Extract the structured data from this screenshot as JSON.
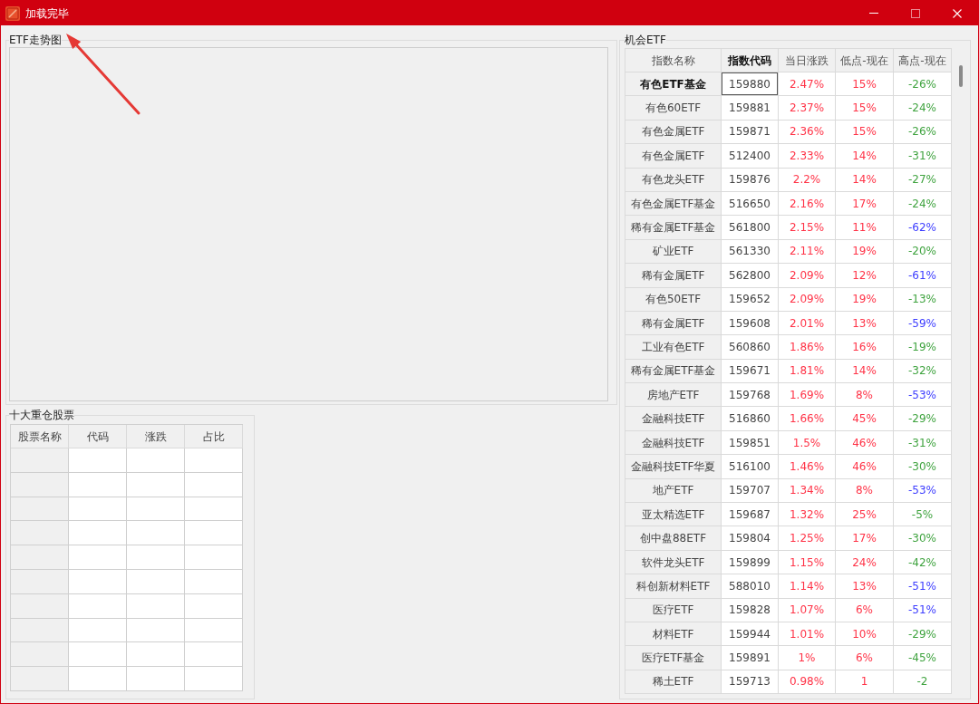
{
  "window": {
    "title": "加载完毕",
    "controls": [
      {
        "kind": "minimize",
        "disabled": false
      },
      {
        "kind": "maximize",
        "disabled": true
      },
      {
        "kind": "close",
        "disabled": false
      }
    ]
  },
  "chart_group": {
    "title": "ETF走势图"
  },
  "holdings": {
    "title": "十大重仓股票",
    "columns": [
      "股票名称",
      "代码",
      "涨跌",
      "占比"
    ]
  },
  "etf_table": {
    "title": "机会ETF",
    "columns": [
      {
        "label": "指数名称",
        "selected": false
      },
      {
        "label": "指数代码",
        "selected": true
      },
      {
        "label": "当日涨跌",
        "selected": false
      },
      {
        "label": "低点-现在",
        "selected": false
      },
      {
        "label": "高点-现在",
        "selected": false
      }
    ],
    "rows": [
      {
        "name": "有色ETF基金",
        "code": "159880",
        "day_change": "2.47%",
        "low_to_now": "15%",
        "high_to_now": "-26%",
        "color": "#3fa33f",
        "selected": true
      },
      {
        "name": "有色60ETF",
        "code": "159881",
        "day_change": "2.37%",
        "low_to_now": "15%",
        "high_to_now": "-24%",
        "color": "#3fa33f",
        "selected": false
      },
      {
        "name": "有色金属ETF",
        "code": "159871",
        "day_change": "2.36%",
        "low_to_now": "15%",
        "high_to_now": "-26%",
        "color": "#3fa33f",
        "selected": false
      },
      {
        "name": "有色金属ETF",
        "code": "512400",
        "day_change": "2.33%",
        "low_to_now": "14%",
        "high_to_now": "-31%",
        "color": "#3fa33f",
        "selected": false
      },
      {
        "name": "有色龙头ETF",
        "code": "159876",
        "day_change": "2.2%",
        "low_to_now": "14%",
        "high_to_now": "-27%",
        "color": "#3fa33f",
        "selected": false
      },
      {
        "name": "有色金属ETF基金",
        "code": "516650",
        "day_change": "2.16%",
        "low_to_now": "17%",
        "high_to_now": "-24%",
        "color": "#3fa33f",
        "selected": false
      },
      {
        "name": "稀有金属ETF基金",
        "code": "561800",
        "day_change": "2.15%",
        "low_to_now": "11%",
        "high_to_now": "-62%",
        "color": "#3d3dff",
        "selected": false
      },
      {
        "name": "矿业ETF",
        "code": "561330",
        "day_change": "2.11%",
        "low_to_now": "19%",
        "high_to_now": "-20%",
        "color": "#3fa33f",
        "selected": false
      },
      {
        "name": "稀有金属ETF",
        "code": "562800",
        "day_change": "2.09%",
        "low_to_now": "12%",
        "high_to_now": "-61%",
        "color": "#3d3dff",
        "selected": false
      },
      {
        "name": "有色50ETF",
        "code": "159652",
        "day_change": "2.09%",
        "low_to_now": "19%",
        "high_to_now": "-13%",
        "color": "#3fa33f",
        "selected": false
      },
      {
        "name": "稀有金属ETF",
        "code": "159608",
        "day_change": "2.01%",
        "low_to_now": "13%",
        "high_to_now": "-59%",
        "color": "#3d3dff",
        "selected": false
      },
      {
        "name": "工业有色ETF",
        "code": "560860",
        "day_change": "1.86%",
        "low_to_now": "16%",
        "high_to_now": "-19%",
        "color": "#3fa33f",
        "selected": false
      },
      {
        "name": "稀有金属ETF基金",
        "code": "159671",
        "day_change": "1.81%",
        "low_to_now": "14%",
        "high_to_now": "-32%",
        "color": "#3fa33f",
        "selected": false
      },
      {
        "name": "房地产ETF",
        "code": "159768",
        "day_change": "1.69%",
        "low_to_now": "8%",
        "high_to_now": "-53%",
        "color": "#3d3dff",
        "selected": false
      },
      {
        "name": "金融科技ETF",
        "code": "516860",
        "day_change": "1.66%",
        "low_to_now": "45%",
        "high_to_now": "-29%",
        "color": "#3fa33f",
        "selected": false
      },
      {
        "name": "金融科技ETF",
        "code": "159851",
        "day_change": "1.5%",
        "low_to_now": "46%",
        "high_to_now": "-31%",
        "color": "#3fa33f",
        "selected": false
      },
      {
        "name": "金融科技ETF华夏",
        "code": "516100",
        "day_change": "1.46%",
        "low_to_now": "46%",
        "high_to_now": "-30%",
        "color": "#3fa33f",
        "selected": false
      },
      {
        "name": "地产ETF",
        "code": "159707",
        "day_change": "1.34%",
        "low_to_now": "8%",
        "high_to_now": "-53%",
        "color": "#3d3dff",
        "selected": false
      },
      {
        "name": "亚太精选ETF",
        "code": "159687",
        "day_change": "1.32%",
        "low_to_now": "25%",
        "high_to_now": "-5%",
        "color": "#3fa33f",
        "selected": false
      },
      {
        "name": "创中盘88ETF",
        "code": "159804",
        "day_change": "1.25%",
        "low_to_now": "17%",
        "high_to_now": "-30%",
        "color": "#3fa33f",
        "selected": false
      },
      {
        "name": "软件龙头ETF",
        "code": "159899",
        "day_change": "1.15%",
        "low_to_now": "24%",
        "high_to_now": "-42%",
        "color": "#3fa33f",
        "selected": false
      },
      {
        "name": "科创新材料ETF",
        "code": "588010",
        "day_change": "1.14%",
        "low_to_now": "13%",
        "high_to_now": "-51%",
        "color": "#3d3dff",
        "selected": false
      },
      {
        "name": "医疗ETF",
        "code": "159828",
        "day_change": "1.07%",
        "low_to_now": "6%",
        "high_to_now": "-51%",
        "color": "#3d3dff",
        "selected": false
      },
      {
        "name": "材料ETF",
        "code": "159944",
        "day_change": "1.01%",
        "low_to_now": "10%",
        "high_to_now": "-29%",
        "color": "#3fa33f",
        "selected": false
      },
      {
        "name": "医疗ETF基金",
        "code": "159891",
        "day_change": "1%",
        "low_to_now": "6%",
        "high_to_now": "-45%",
        "color": "#3fa33f",
        "selected": false
      },
      {
        "name": "稀土ETF",
        "code": "159713",
        "day_change": "0.98%",
        "low_to_now": "1",
        "high_to_now": "-2",
        "color": "#3fa33f",
        "selected": false
      }
    ]
  }
}
